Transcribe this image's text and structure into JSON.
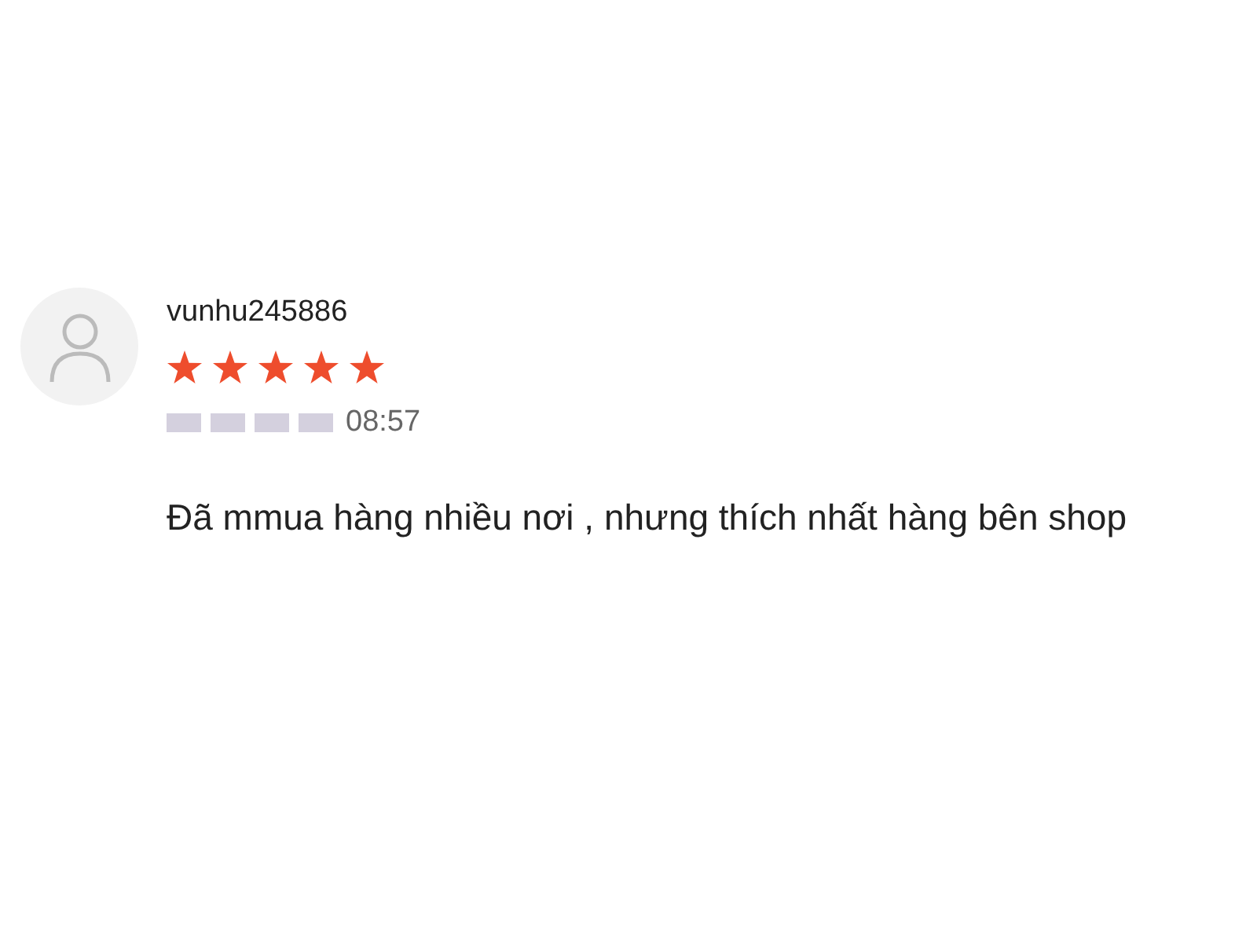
{
  "review": {
    "username": "vunhu245886",
    "stars": 5,
    "time": "08:57",
    "text": "Đã mmua hàng nhiều nơi , nhưng thích nhất hàng bên shop"
  }
}
